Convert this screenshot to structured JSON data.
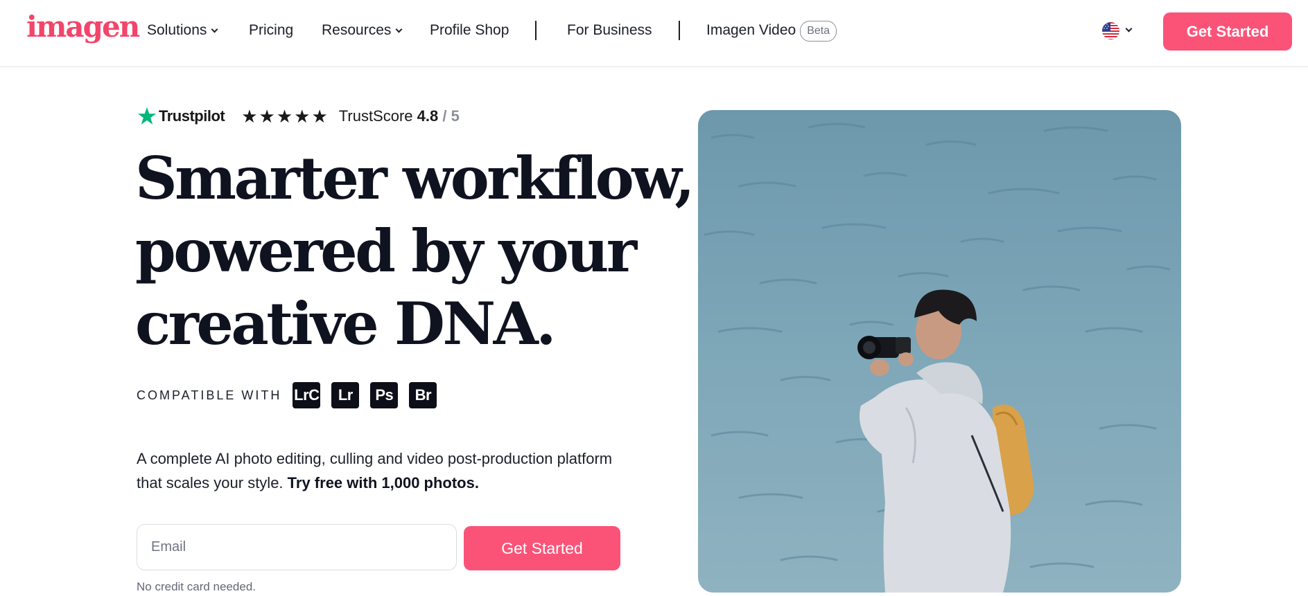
{
  "nav": {
    "logo": "imagen",
    "items": [
      {
        "label": "Solutions",
        "dropdown": true
      },
      {
        "label": "Pricing",
        "dropdown": false
      },
      {
        "label": "Resources",
        "dropdown": true
      },
      {
        "label": "Profile Shop",
        "dropdown": false
      },
      {
        "label": "For Business",
        "dropdown": false
      },
      {
        "label": "Imagen Video",
        "dropdown": false
      }
    ],
    "beta_badge": "Beta",
    "language_icon": "us-flag-icon",
    "cta": "Get Started"
  },
  "trustpilot": {
    "brand": "Trustpilot",
    "stars": "★★★★★",
    "score_label": "TrustScore",
    "score": "4.8",
    "out_of": "/ 5"
  },
  "hero": {
    "headline": [
      "Smarter workflow,",
      "powered by your",
      "creative DNA."
    ],
    "compatible_label": "COMPATIBLE WITH",
    "apps": [
      "LrC",
      "Lr",
      "Ps",
      "Br"
    ],
    "description": "A complete AI photo editing, culling and video post-production platform that scales your style.",
    "description_bold": "Try free with 1,000 photos.",
    "email_placeholder": "Email",
    "email_value": "",
    "cta": "Get Started",
    "note": "No credit card needed."
  },
  "colors": {
    "brand": "#fb5378",
    "logo": "#f2456a",
    "trustpilot_green": "#00b67a",
    "text": "#121826"
  }
}
